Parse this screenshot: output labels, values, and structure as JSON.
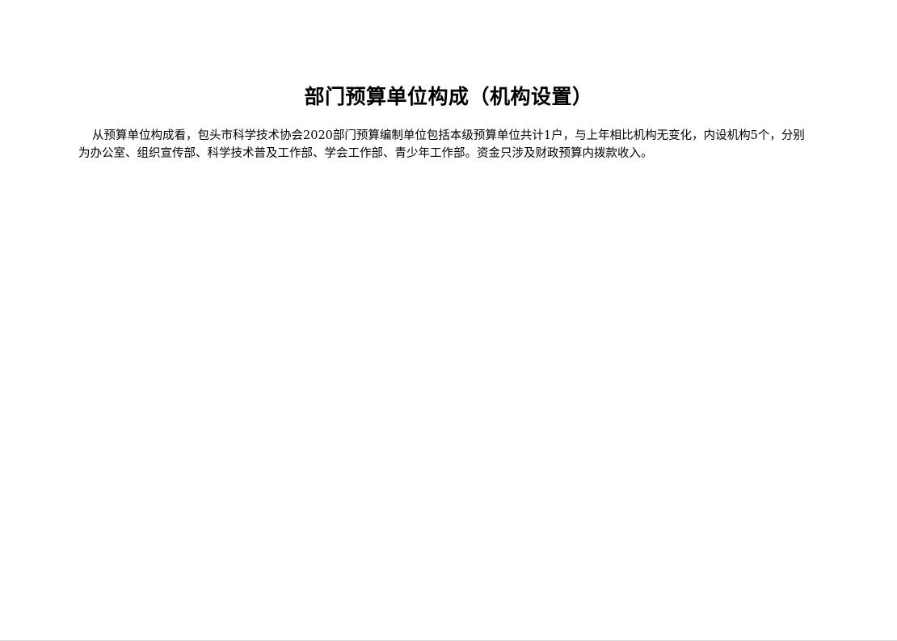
{
  "document": {
    "title": "部门预算单位构成（机构设置）",
    "paragraph": "从预算单位构成看，包头市科学技术协会2020部门预算编制单位包括本级预算单位共计1户，与上年相比机构无变化，内设机构5个，分别为办公室、组织宣传部、科学技术普及工作部、学会工作部、青少年工作部。资金只涉及财政预算内拨款收入。"
  }
}
